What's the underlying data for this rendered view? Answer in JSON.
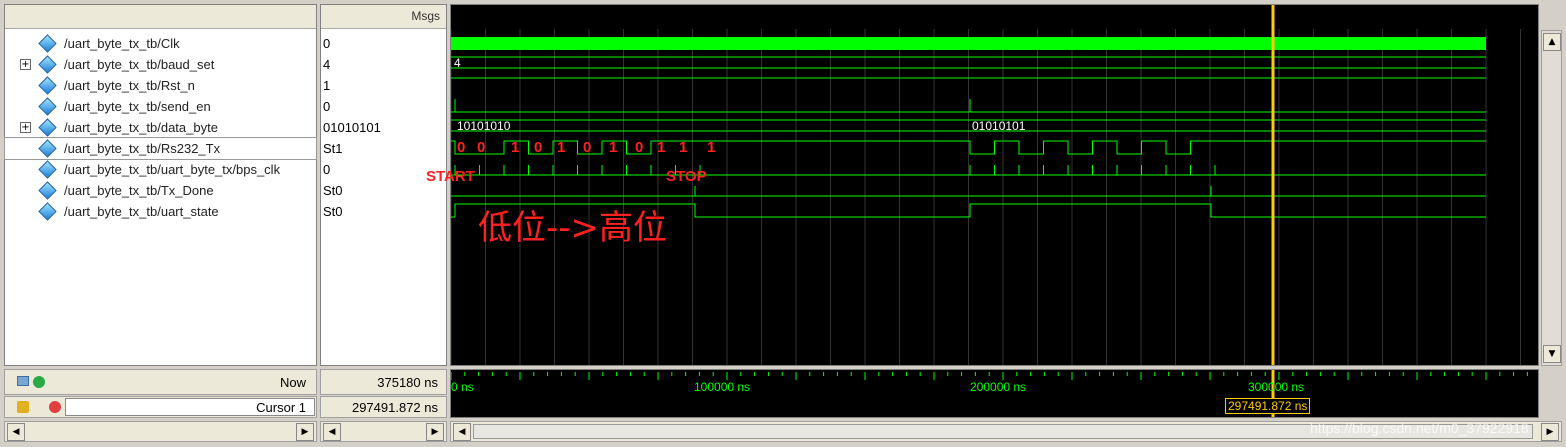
{
  "header": {
    "msgs_label": "Msgs"
  },
  "signals": [
    {
      "name": "/uart_byte_tx_tb/Clk",
      "value": "0",
      "expandable": false
    },
    {
      "name": "/uart_byte_tx_tb/baud_set",
      "value": "4",
      "expandable": true
    },
    {
      "name": "/uart_byte_tx_tb/Rst_n",
      "value": "1",
      "expandable": false
    },
    {
      "name": "/uart_byte_tx_tb/send_en",
      "value": "0",
      "expandable": false
    },
    {
      "name": "/uart_byte_tx_tb/data_byte",
      "value": "01010101",
      "expandable": true
    },
    {
      "name": "/uart_byte_tx_tb/Rs232_Tx",
      "value": "St1",
      "expandable": false
    },
    {
      "name": "/uart_byte_tx_tb/uart_byte_tx/bps_clk",
      "value": "0",
      "expandable": false
    },
    {
      "name": "/uart_byte_tx_tb/Tx_Done",
      "value": "St0",
      "expandable": false
    },
    {
      "name": "/uart_byte_tx_tb/uart_state",
      "value": "St0",
      "expandable": false
    }
  ],
  "waveform": {
    "baud_set_label": "4",
    "data_byte_labels": [
      "10101010",
      "01010101"
    ],
    "bit_labels": [
      "0",
      "0",
      "1",
      "0",
      "1",
      "0",
      "1",
      "0",
      "1",
      "1",
      "1"
    ],
    "start_label": "START",
    "stop_label": "STOP",
    "annotation": "低位-->高位"
  },
  "status": {
    "now_label": "Now",
    "now_value": "375180 ns",
    "cursor_label": "Cursor 1",
    "cursor_value": "297491.872 ns",
    "cursor_flag": "297491.872 ns"
  },
  "timeline": {
    "ticks": [
      "0 ns",
      "100000 ns",
      "200000 ns",
      "300000 ns"
    ]
  },
  "watermark": "https://blog.csdn.net/m0_37922918",
  "colors": {
    "wave": "#00ff00",
    "cursor": "#ffcc00",
    "annotation": "#ff2020",
    "grid": "#333333"
  }
}
